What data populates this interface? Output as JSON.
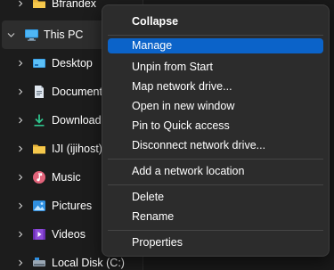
{
  "colors": {
    "background": "#191919",
    "nav_background": "#1c1c1c",
    "selected_row": "#2d2d2d",
    "menu_background": "#2c2c2c",
    "menu_highlight": "#0b63c9",
    "text": "#ffffff"
  },
  "nav": {
    "items": [
      {
        "label": "Bfrandex",
        "icon": "folder-icon"
      },
      {
        "label": "This PC",
        "icon": "computer-icon",
        "expanded": true,
        "selected": true
      },
      {
        "label": "Desktop",
        "icon": "desktop-icon"
      },
      {
        "label": "Documents",
        "icon": "documents-icon"
      },
      {
        "label": "Downloads",
        "icon": "downloads-icon"
      },
      {
        "label": "IJI (ijihost)",
        "icon": "folder-icon"
      },
      {
        "label": "Music",
        "icon": "music-icon"
      },
      {
        "label": "Pictures",
        "icon": "pictures-icon"
      },
      {
        "label": "Videos",
        "icon": "videos-icon"
      },
      {
        "label": "Local Disk (C:)",
        "icon": "drive-icon"
      }
    ]
  },
  "menu": {
    "items": [
      {
        "label": "Collapse",
        "bold": true
      },
      {
        "label": "Manage",
        "highlighted": true
      },
      {
        "label": "Unpin from Start"
      },
      {
        "label": "Map network drive..."
      },
      {
        "label": "Open in new window"
      },
      {
        "label": "Pin to Quick access"
      },
      {
        "label": "Disconnect network drive..."
      },
      {
        "label": "Add a network location"
      },
      {
        "label": "Delete"
      },
      {
        "label": "Rename"
      },
      {
        "label": "Properties"
      }
    ]
  }
}
